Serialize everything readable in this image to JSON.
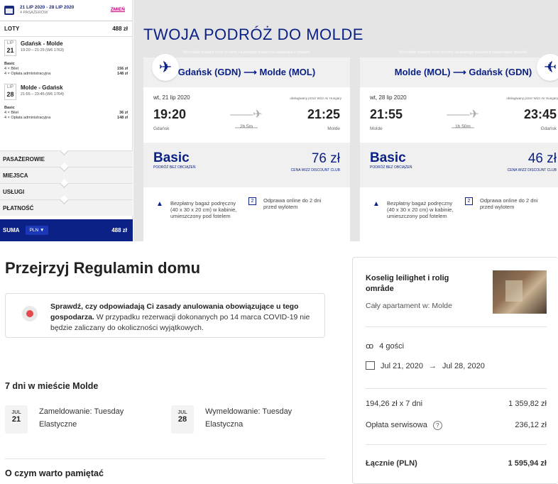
{
  "sidebar": {
    "dates": "21 LIP 2020 - 28 LIP 2020",
    "passengers": "4 PASAŻERÓW",
    "change": "ZMIEŃ",
    "loty_label": "LOTY",
    "loty_total": "488 zł",
    "flights": [
      {
        "month": "LIP",
        "day": "21",
        "route": "Gdańsk - Molde",
        "time": "19:20 – 21:25 (W6 1763)",
        "fare": "Basic",
        "l1": "4 × Bilet",
        "v1": "156 zł",
        "l2": "4 × Opłata administracyjna",
        "v2": "148 zł"
      },
      {
        "month": "LIP",
        "day": "28",
        "route": "Molde - Gdańsk",
        "time": "21:55 – 23:45 (W6 1764)",
        "fare": "Basic",
        "l1": "4 × Bilet",
        "v1": "36 zł",
        "l2": "4 × Opłata administracyjna",
        "v2": "148 zł"
      }
    ],
    "sections": [
      "PASAŻEROWIE",
      "MIEJSCA",
      "USŁUGI",
      "PŁATNOŚĆ"
    ],
    "suma": "SUMA",
    "currency": "PLN",
    "suma_total": "488 zł"
  },
  "main": {
    "title": "TWOJA PODRÓŻ DO MOLDE",
    "cards": [
      {
        "note": "Wszystkie podane ceny to ceny za jednego pasażera zawierające podatki.",
        "route": "Gdańsk (GDN) ⟶ Molde (MOL)",
        "date": "wt, 21 lip 2020",
        "operated": "obsługiwany przez Wizz Air Hungary",
        "dep": "19:20",
        "arr": "21:25",
        "from": "Gdańsk",
        "to": "Molde",
        "duration": "2h 5m",
        "fare": "Basic",
        "fare_sub": "PODRÓŻ BEZ OBCIĄŻEŃ",
        "price": "76 zł",
        "price_sub": "CENA WIZZ DISCOUNT CLUB",
        "perk1": "Bezpłatny bagaż podręczny (40 x 30 x 20 cm) w kabinie, umieszczony pod fotelem",
        "perk2": "Odprawa online do 2 dni przed wylotem"
      },
      {
        "note": "Wszystkie podane ceny to ceny za jednego pasażera zawierające podatki.",
        "route": "Molde (MOL) ⟶ Gdańsk (GDN)",
        "date": "wt, 28 lip 2020",
        "operated": "obsługiwany przez Wizz Air Hungary",
        "dep": "21:55",
        "arr": "23:45",
        "from": "Molde",
        "to": "Gdańsk",
        "duration": "1h 50m",
        "fare": "Basic",
        "fare_sub": "PODRÓŻ BEZ OBCIĄŻEŃ",
        "price": "46 zł",
        "price_sub": "CENA WIZZ DISCOUNT CLUB",
        "perk1": "Bezpłatny bagaż podręczny (40 x 30 x 20 cm) w kabinie, umieszczony pod fotelem",
        "perk2": "Odprawa online do 2 dni przed wylotem"
      }
    ]
  },
  "house": {
    "title": "Przejrzyj Regulamin domu",
    "notice_bold": "Sprawdź, czy odpowiadają Ci zasady anulowania obowiązujące u tego gospodarza.",
    "notice_rest": " W przypadku rezerwacji dokonanych po 14 marca COVID-19 nie będzie zaliczany do okoliczności wyjątkowych.",
    "stay": "7 dni w mieście Molde",
    "checkin": {
      "month": "JUL",
      "day": "21",
      "label": "Zameldowanie: Tuesday",
      "flex": "Elastyczne"
    },
    "checkout": {
      "month": "JUL",
      "day": "28",
      "label": "Wymeldowanie: Tuesday",
      "flex": "Elastyczna"
    },
    "remember": "O czym warto pamiętać"
  },
  "booking": {
    "name": "Koselig leilighet i rolig område",
    "type": "Cały apartament w: Molde",
    "guests": "4 gości",
    "date_from": "Jul 21, 2020",
    "date_to": "Jul 28, 2020",
    "nightly": "194,26 zł x 7 dni",
    "nightly_total": "1 359,82 zł",
    "service": "Opłata serwisowa",
    "service_total": "236,12 zł",
    "total_label": "Łącznie (PLN)",
    "total": "1 595,94 zł"
  }
}
